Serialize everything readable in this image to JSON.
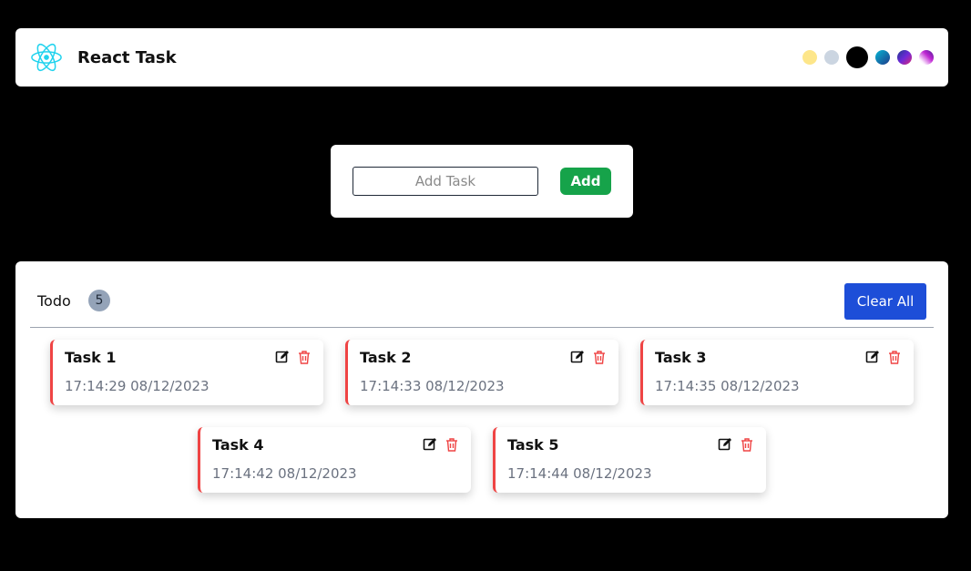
{
  "header": {
    "app_title": "React Task",
    "logo_icon": "react-logo-icon",
    "themes": [
      {
        "name": "theme-yellow",
        "color": "#fde68a"
      },
      {
        "name": "theme-light",
        "color": "#cbd5e1"
      },
      {
        "name": "theme-black",
        "color": "#000000"
      },
      {
        "name": "theme-blue-gradient",
        "color": "#1e40af"
      },
      {
        "name": "theme-violet-gradient",
        "color": "#4c1d95"
      },
      {
        "name": "theme-pink-gradient",
        "color": "#c026d3"
      }
    ]
  },
  "add_form": {
    "input_placeholder": "Add Task",
    "input_value": "",
    "add_label": "Add"
  },
  "todo": {
    "label": "Todo",
    "count": "5",
    "clear_label": "Clear All",
    "tasks": [
      {
        "name": "Task 1",
        "time": "17:14:29 08/12/2023"
      },
      {
        "name": "Task 2",
        "time": "17:14:33 08/12/2023"
      },
      {
        "name": "Task 3",
        "time": "17:14:35 08/12/2023"
      },
      {
        "name": "Task 4",
        "time": "17:14:42 08/12/2023"
      },
      {
        "name": "Task 5",
        "time": "17:14:44 08/12/2023"
      }
    ]
  },
  "colors": {
    "accent_red": "#ef4444",
    "add_green": "#16a34a",
    "clear_blue": "#1d4ed8"
  }
}
